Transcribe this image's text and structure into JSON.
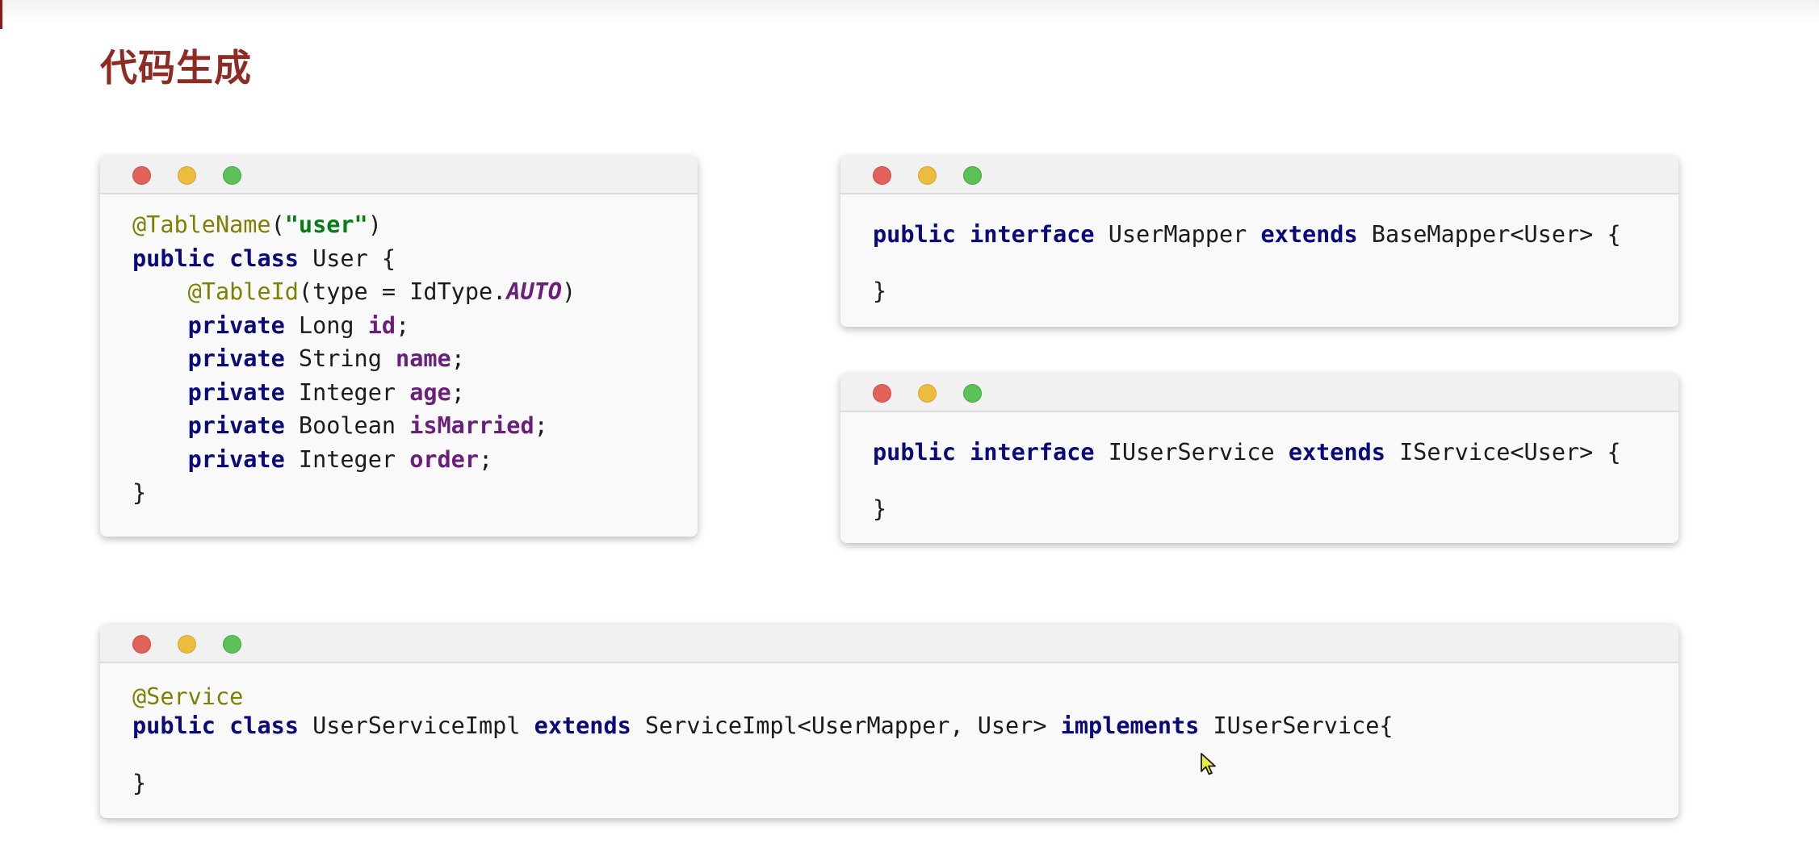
{
  "title": "代码生成",
  "window_controls": {
    "close": "red",
    "minimize": "yellow",
    "maximize": "green"
  },
  "entity_window": {
    "ann_name": "@TableName",
    "table_arg": "\"user\"",
    "kw_public": "public",
    "kw_class": "class",
    "class_name": "User",
    "ann_id": "@TableId",
    "id_type_prefix": "(type = IdType.",
    "id_type_value": "AUTO",
    "kw_private": "private",
    "fields": [
      {
        "type": "Long",
        "name": "id"
      },
      {
        "type": "String",
        "name": "name"
      },
      {
        "type": "Integer",
        "name": "age"
      },
      {
        "type": "Boolean",
        "name": "isMarried"
      },
      {
        "type": "Integer",
        "name": "order"
      }
    ]
  },
  "mapper_window": {
    "kw_public": "public",
    "kw_interface": "interface",
    "name": "UserMapper",
    "kw_extends": "extends",
    "parent": "BaseMapper<User>"
  },
  "service_window": {
    "kw_public": "public",
    "kw_interface": "interface",
    "name": "IUserService",
    "kw_extends": "extends",
    "parent": "IService<User>"
  },
  "impl_window": {
    "annotation": "@Service",
    "kw_public": "public",
    "kw_class": "class",
    "name": "UserServiceImpl",
    "kw_extends": "extends",
    "parent": "ServiceImpl<UserMapper, User>",
    "kw_implements": "implements",
    "interface": "IUserService{"
  }
}
